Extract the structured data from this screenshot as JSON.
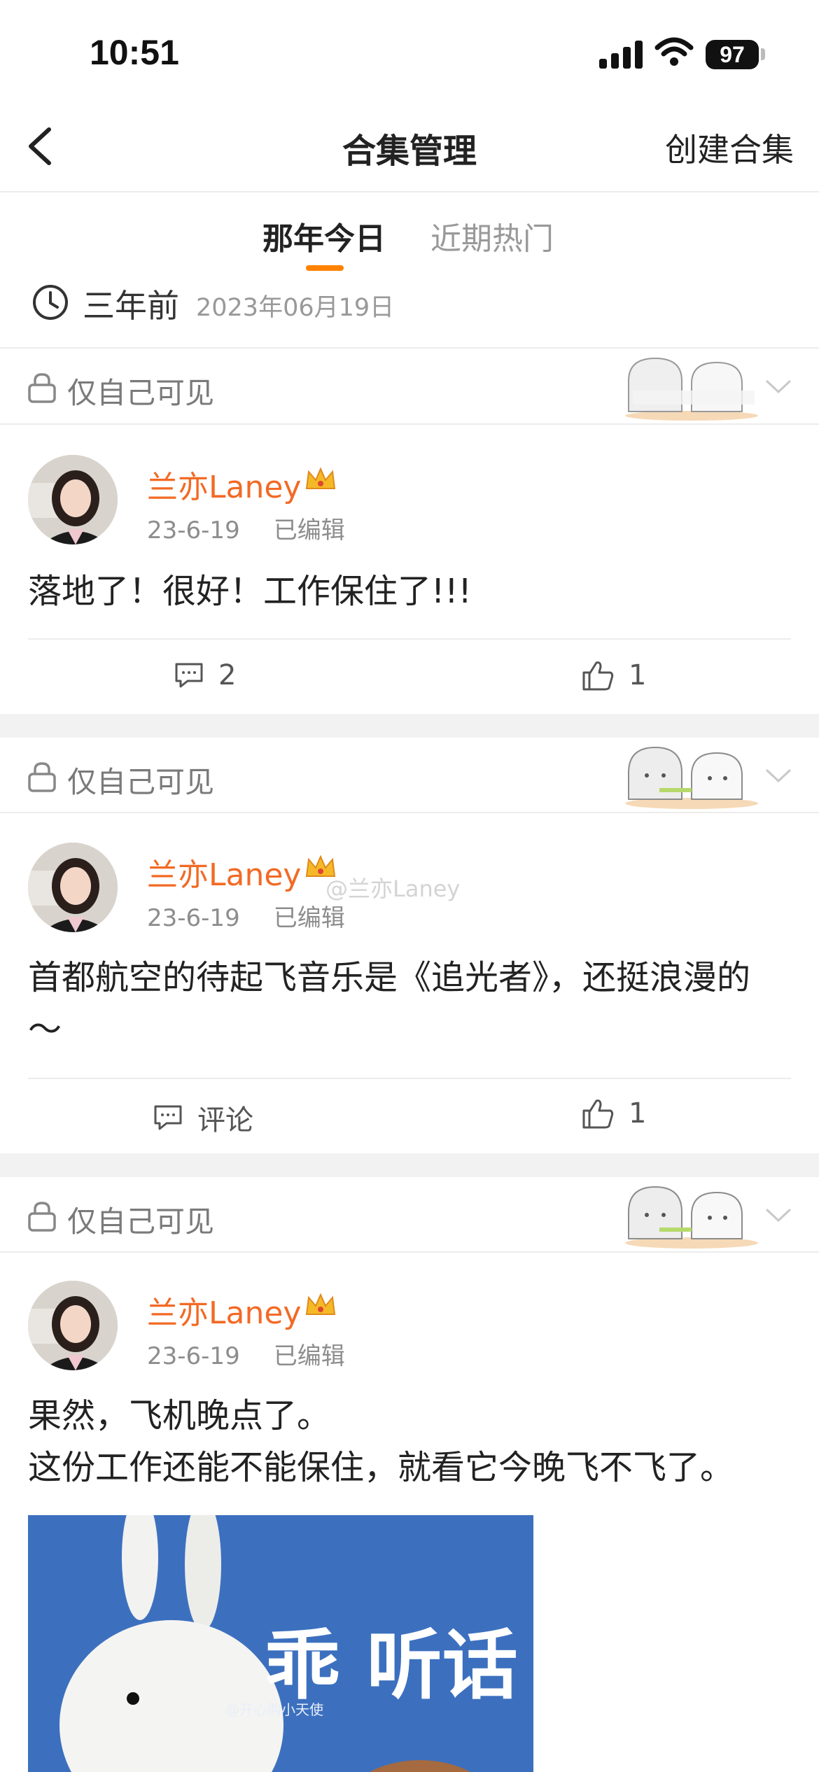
{
  "status_bar": {
    "time": "10:51",
    "battery": "97"
  },
  "nav": {
    "title": "合集管理",
    "right_action": "创建合集"
  },
  "tabs": [
    {
      "label": "那年今日",
      "active": true
    },
    {
      "label": "近期热门",
      "active": false
    }
  ],
  "date_header": {
    "relative": "三年前",
    "date": "2023年06月19日"
  },
  "posts": [
    {
      "visibility": "仅自己可见",
      "author": "兰亦Laney",
      "time": "23-6-19",
      "edited": "已编辑",
      "text": [
        "落地了！很好！工作保住了!!!"
      ],
      "comment_label": "2",
      "like_count": "1"
    },
    {
      "visibility": "仅自己可见",
      "author": "兰亦Laney",
      "time": "23-6-19",
      "edited": "已编辑",
      "text": [
        "首都航空的待起飞音乐是《追光者》，还挺浪漫的",
        "～"
      ],
      "comment_label": "评论",
      "like_count": "1"
    },
    {
      "visibility": "仅自己可见",
      "author": "兰亦Laney",
      "time": "23-6-19",
      "edited": "已编辑",
      "text": [
        "果然，飞机晚点了。",
        "这份工作还能不能保住，就看它今晚飞不飞了。"
      ],
      "image": {
        "caption": "乖 听话",
        "watermark": "@开心购小天使"
      }
    }
  ],
  "watermark": "@兰亦Laney",
  "icons": [
    "back-chevron-icon",
    "clock-icon",
    "lock-icon",
    "chevron-down-icon",
    "comment-icon",
    "thumbs-up-icon",
    "crown-badge-icon",
    "signal-icon",
    "wifi-icon",
    "battery-icon"
  ],
  "colors": {
    "accent": "#ff8200",
    "author": "#f26a25",
    "muted": "#999999"
  }
}
